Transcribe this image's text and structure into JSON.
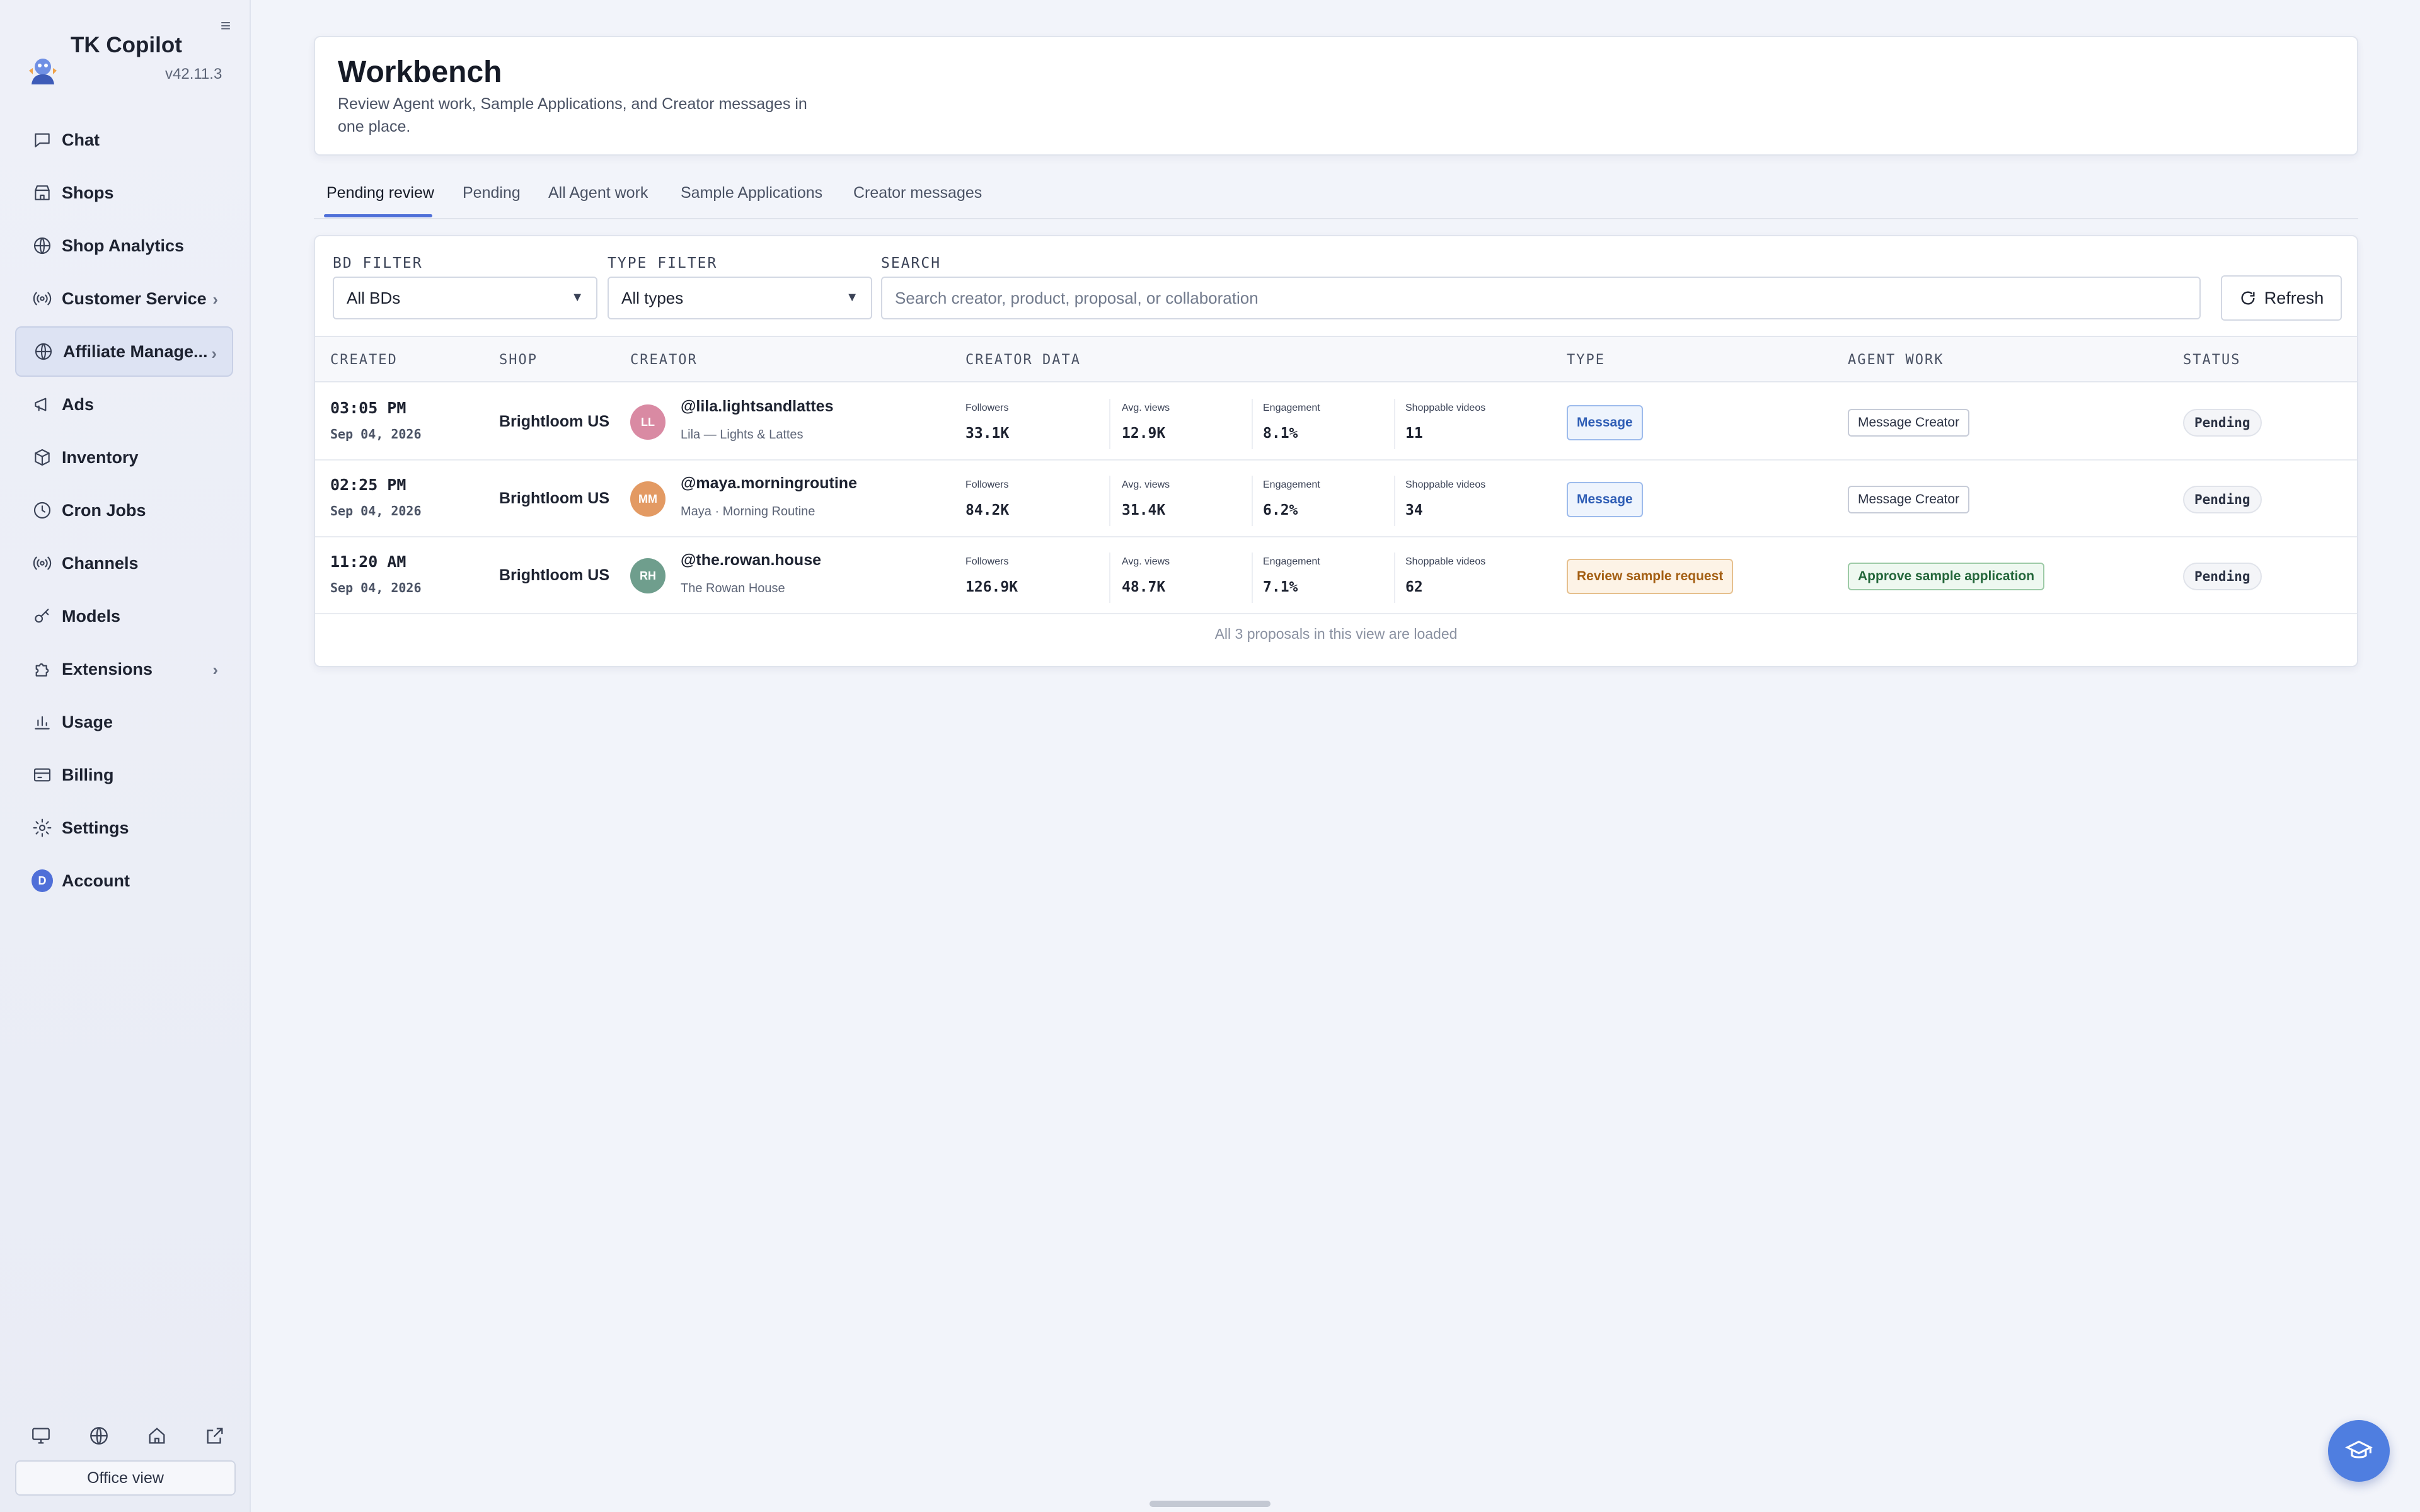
{
  "app": {
    "name": "TK Copilot",
    "version": "v42.11.3",
    "collapse_icon": "menu-icon"
  },
  "sidebar": {
    "items": [
      {
        "label": "Chat",
        "icon": "chat-icon"
      },
      {
        "label": "Shops",
        "icon": "store-icon"
      },
      {
        "label": "Shop Analytics",
        "icon": "globe-icon"
      },
      {
        "label": "Customer Service",
        "icon": "broadcast-icon",
        "has_chevron": true
      },
      {
        "label": "Affiliate Manage...",
        "icon": "globe-icon",
        "has_chevron": true,
        "active": true
      },
      {
        "label": "Ads",
        "icon": "megaphone-icon"
      },
      {
        "label": "Inventory",
        "icon": "box-icon"
      },
      {
        "label": "Cron Jobs",
        "icon": "clock-icon"
      },
      {
        "label": "Channels",
        "icon": "broadcast-icon"
      },
      {
        "label": "Models",
        "icon": "key-icon"
      },
      {
        "label": "Extensions",
        "icon": "puzzle-icon",
        "has_chevron": true
      },
      {
        "label": "Usage",
        "icon": "bar-chart-icon"
      },
      {
        "label": "Billing",
        "icon": "credit-card-icon"
      },
      {
        "label": "Settings",
        "icon": "gear-icon"
      },
      {
        "label": "Account",
        "icon": "avatar",
        "avatar_letter": "D"
      }
    ],
    "chevron": "›",
    "footer_icons": [
      "monitor-icon",
      "globe-icon",
      "home-icon",
      "external-link-icon"
    ],
    "office_view_label": "Office view"
  },
  "header": {
    "title": "Workbench",
    "subtitle": "Review Agent work, Sample Applications, and Creator messages in one place."
  },
  "tabs": [
    {
      "label": "Pending review",
      "active": true
    },
    {
      "label": "Pending"
    },
    {
      "label": "All Agent work"
    },
    {
      "label": "Sample Applications"
    },
    {
      "label": "Creator messages"
    }
  ],
  "filters": {
    "bd_label": "BD FILTER",
    "bd_value": "All BDs",
    "type_label": "TYPE FILTER",
    "type_value": "All types",
    "search_label": "SEARCH",
    "search_placeholder": "Search creator, product, proposal, or collaboration",
    "caret": "▼",
    "refresh_label": "Refresh"
  },
  "table": {
    "columns": [
      "CREATED",
      "SHOP",
      "CREATOR",
      "CREATOR DATA",
      "TYPE",
      "AGENT WORK",
      "STATUS"
    ],
    "metric_labels": [
      "Followers",
      "Avg. views",
      "Engagement",
      "Shoppable videos"
    ],
    "rows": [
      {
        "time": "03:05 PM",
        "date": "Sep 04, 2026",
        "shop": "Brightloom US",
        "initials": "LL",
        "avatar_color": "#d98aa3",
        "handle": "@lila.lightsandlattes",
        "name": "Lila — Lights & Lattes",
        "followers": "33.1K",
        "avg_views": "12.9K",
        "engagement": "8.1%",
        "videos": "11",
        "type": "Message",
        "type_style": "message",
        "agent_work": "Message Creator",
        "agent_style": "plain",
        "status": "Pending"
      },
      {
        "time": "02:25 PM",
        "date": "Sep 04, 2026",
        "shop": "Brightloom US",
        "initials": "MM",
        "avatar_color": "#e39a63",
        "handle": "@maya.morningroutine",
        "name": "Maya · Morning Routine",
        "followers": "84.2K",
        "avg_views": "31.4K",
        "engagement": "6.2%",
        "videos": "34",
        "type": "Message",
        "type_style": "message",
        "agent_work": "Message Creator",
        "agent_style": "plain",
        "status": "Pending"
      },
      {
        "time": "11:20 AM",
        "date": "Sep 04, 2026",
        "shop": "Brightloom US",
        "initials": "RH",
        "avatar_color": "#6f9e8d",
        "handle": "@the.rowan.house",
        "name": "The Rowan House",
        "followers": "126.9K",
        "avg_views": "48.7K",
        "engagement": "7.1%",
        "videos": "62",
        "type": "Review sample request",
        "type_style": "review",
        "agent_work": "Approve sample application",
        "agent_style": "approve",
        "status": "Pending"
      }
    ],
    "footer": "All 3 proposals in this view are loaded"
  },
  "help_button_icon": "graduation-cap-icon"
}
